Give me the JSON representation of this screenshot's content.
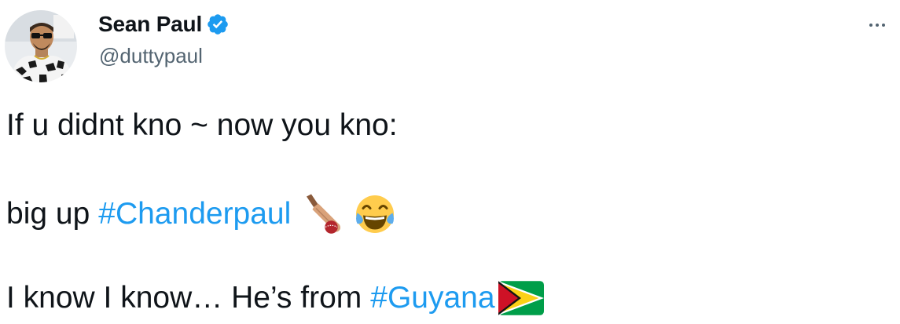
{
  "author": {
    "display_name": "Sean Paul",
    "handle": "@duttypaul",
    "verified": true
  },
  "tweet": {
    "line1": "If u didnt kno ~ now you kno:",
    "line2_prefix": "big up",
    "line2_hashtag": "#Chanderpaul",
    "line3_prefix": "I know I know… He’s from",
    "line3_hashtag": "#Guyana"
  },
  "icons": {
    "verified": "verified-badge-icon",
    "more": "more-options-icon",
    "emoji_1": "cricket-bat-emoji",
    "emoji_2": "face-with-tears-of-joy-emoji",
    "emoji_3": "guyana-flag-emoji"
  },
  "colors": {
    "text": "#0f1419",
    "secondary": "#536471",
    "link": "#1d9bf0",
    "verified": "#1d9bf0"
  }
}
